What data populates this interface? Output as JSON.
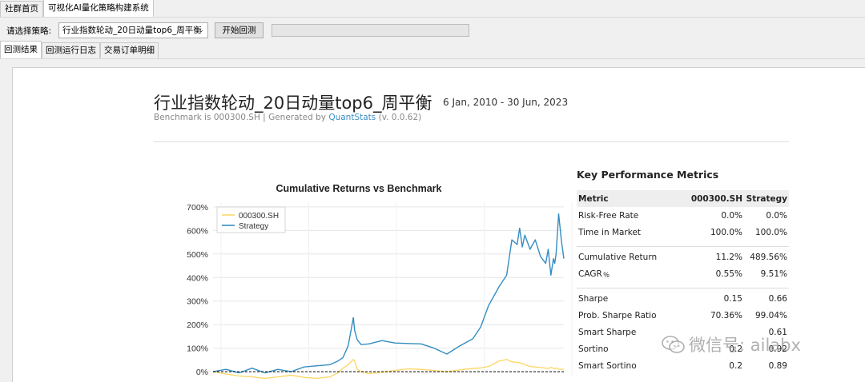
{
  "top_tabs": [
    {
      "label": "社群首页"
    },
    {
      "label": "可视化AI量化策略构建系统"
    }
  ],
  "toolbar": {
    "strategy_label": "请选择策略:",
    "strategy_value": "行业指数轮动_20日动量top6_周平衡",
    "start_button": "开始回测"
  },
  "sub_tabs": [
    {
      "label": "回测结果"
    },
    {
      "label": "回测运行日志"
    },
    {
      "label": "交易订单明细"
    }
  ],
  "report": {
    "title": "行业指数轮动_20日动量top6_周平衡",
    "date_range": "6 Jan, 2010 - 30 Jun, 2023",
    "subtitle_prefix": "Benchmark is 000300.SH | Generated by ",
    "subtitle_link": "QuantStats",
    "subtitle_suffix": " (v. 0.0.62)"
  },
  "chart_data": {
    "type": "line",
    "title": "Cumulative Returns vs Benchmark",
    "xlabel": "",
    "ylabel": "",
    "y_ticks": [
      "0%",
      "100%",
      "200%",
      "300%",
      "400%",
      "500%",
      "600%",
      "700%"
    ],
    "ylim": [
      -20,
      720
    ],
    "grid": true,
    "legend_position": "top-left",
    "x": [
      2010.0,
      2010.5,
      2011.0,
      2011.5,
      2012.0,
      2012.5,
      2013.0,
      2013.5,
      2014.0,
      2014.5,
      2014.8,
      2015.0,
      2015.2,
      2015.4,
      2015.45,
      2015.55,
      2015.7,
      2016.0,
      2016.5,
      2017.0,
      2017.5,
      2018.0,
      2018.5,
      2019.0,
      2019.5,
      2020.0,
      2020.3,
      2020.6,
      2021.0,
      2021.3,
      2021.5,
      2021.7,
      2021.8,
      2021.9,
      2022.0,
      2022.2,
      2022.4,
      2022.6,
      2022.8,
      2022.9,
      2023.0,
      2023.1,
      2023.15,
      2023.2,
      2023.3,
      2023.4,
      2023.5
    ],
    "series": [
      {
        "name": "000300.SH",
        "color": "#fcd86b",
        "values": [
          0,
          -10,
          -18,
          -22,
          -28,
          -22,
          -15,
          -24,
          -28,
          -22,
          -5,
          15,
          30,
          52,
          45,
          10,
          0,
          -8,
          -2,
          5,
          12,
          10,
          5,
          0,
          8,
          14,
          16,
          22,
          45,
          52,
          42,
          40,
          38,
          35,
          30,
          22,
          20,
          18,
          15,
          14,
          18,
          15,
          13,
          16,
          11,
          10,
          11
        ]
      },
      {
        "name": "Strategy",
        "color": "#348dc1",
        "values": [
          0,
          10,
          -5,
          15,
          -5,
          10,
          0,
          20,
          25,
          30,
          45,
          60,
          110,
          230,
          175,
          135,
          115,
          118,
          132,
          122,
          120,
          118,
          100,
          75,
          110,
          140,
          190,
          280,
          360,
          410,
          560,
          540,
          610,
          530,
          580,
          520,
          560,
          490,
          460,
          520,
          410,
          480,
          460,
          500,
          670,
          560,
          480
        ]
      }
    ]
  },
  "metrics": {
    "title": "Key Performance Metrics",
    "headers": [
      "Metric",
      "000300.SH",
      "Strategy"
    ],
    "groups": [
      [
        [
          "Risk-Free Rate",
          "0.0%",
          "0.0%"
        ],
        [
          "Time in Market",
          "100.0%",
          "100.0%"
        ]
      ],
      [
        [
          "Cumulative Return",
          "11.2%",
          "489.56%"
        ],
        [
          "CAGR﹪",
          "0.55%",
          "9.51%"
        ]
      ],
      [
        [
          "Sharpe",
          "0.15",
          "0.66"
        ],
        [
          "Prob. Sharpe Ratio",
          "70.36%",
          "99.04%"
        ],
        [
          "Smart Sharpe",
          "",
          "0.61"
        ],
        [
          "Sortino",
          "0.2",
          "0.92"
        ],
        [
          "Smart Sortino",
          "0.2",
          "0.89"
        ]
      ]
    ]
  },
  "watermark": {
    "text": "微信号: ailabx"
  }
}
